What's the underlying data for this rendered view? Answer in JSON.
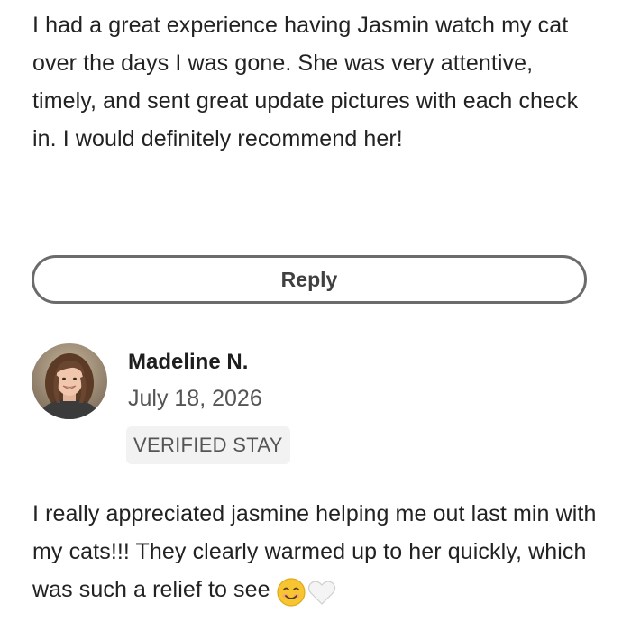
{
  "reviews": [
    {
      "text": "I had a great experience having Jasmin watch my cat over the days I was gone. She was very attentive, timely, and sent great update pictures with each check in. I would definitely recommend her!",
      "reply_label": "Reply"
    },
    {
      "reviewer": "Madeline N.",
      "date": "July 18, 2026",
      "badge": "VERIFIED STAY",
      "text": "I really appreciated jasmine helping me out last min with my cats!!! They clearly warmed up to her quickly, which was such a relief to see",
      "emojis": [
        "smiling-face-icon",
        "white-heart-icon"
      ]
    }
  ],
  "colors": {
    "text": "#222222",
    "muted": "#555555",
    "button_border": "#6b6b6b",
    "badge_bg": "#f2f2f2"
  }
}
